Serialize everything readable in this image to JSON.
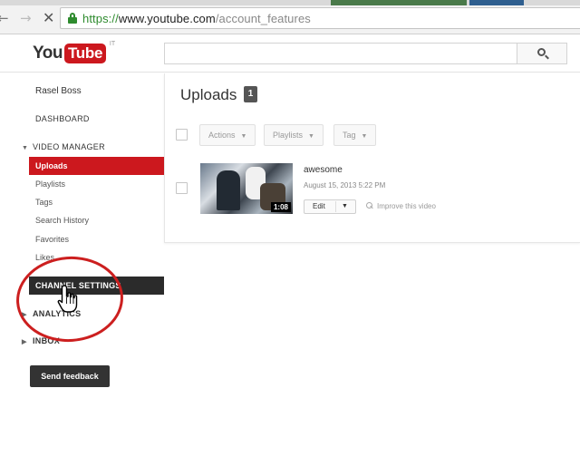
{
  "browser": {
    "url_scheme": "https://",
    "url_host": "www.youtube.com",
    "url_path": "/account_features"
  },
  "header": {
    "logo_you": "You",
    "logo_tube": "Tube",
    "logo_locale": "IT",
    "search_placeholder": ""
  },
  "sidebar": {
    "user_name": "Rasel Boss",
    "dashboard": "DASHBOARD",
    "video_manager": "VIDEO MANAGER",
    "items": [
      {
        "label": "Uploads",
        "active": true
      },
      {
        "label": "Playlists",
        "active": false
      },
      {
        "label": "Tags",
        "active": false
      },
      {
        "label": "Search History",
        "active": false
      },
      {
        "label": "Favorites",
        "active": false
      },
      {
        "label": "Likes",
        "active": false
      }
    ],
    "channel_settings": "CHANNEL SETTINGS",
    "analytics": "ANALYTICS",
    "inbox": "INBOX",
    "feedback": "Send feedback"
  },
  "main": {
    "title": "Uploads",
    "count": "1",
    "toolbar": {
      "actions": "Actions",
      "playlists": "Playlists",
      "tag": "Tag"
    },
    "videos": [
      {
        "title": "awesome",
        "date": "August 15, 2013 5:22 PM",
        "duration": "1:08",
        "edit_label": "Edit",
        "improve_label": "Improve this video"
      }
    ]
  },
  "colors": {
    "brand_red": "#cc181e",
    "annotation_red": "#cc1f1f",
    "dark_button": "#333333",
    "url_green": "#2e8b2e"
  }
}
